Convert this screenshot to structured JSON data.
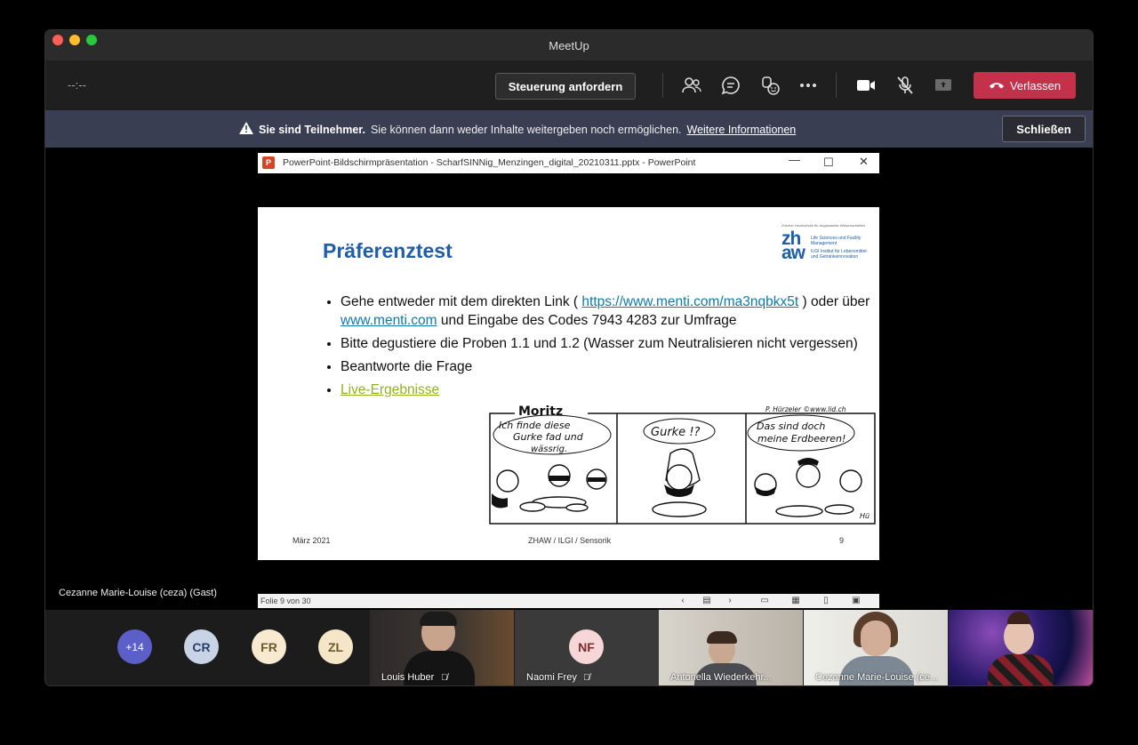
{
  "window": {
    "title": "MeetUp"
  },
  "toolbar": {
    "timer": "--:--",
    "request_control": "Steuerung anfordern",
    "leave": "Verlassen",
    "icons": [
      "people-icon",
      "chat-icon",
      "reactions-icon",
      "more-icon",
      "camera-icon",
      "mic-off-icon",
      "share-icon",
      "phone-icon"
    ]
  },
  "banner": {
    "bold": "Sie sind Teilnehmer.",
    "text": "Sie können dann weder Inhalte weitergeben noch ermöglichen.",
    "link": "Weitere Informationen",
    "close": "Schließen"
  },
  "powerpoint": {
    "title": "PowerPoint-Bildschirmpräsentation  -  ScharfSINNig_Menzingen_digital_20210311.pptx - PowerPoint",
    "status": "Folie 9 von 30"
  },
  "slide": {
    "title": "Präferenztest",
    "logo": {
      "mark_top": "zh",
      "mark_bottom": "aw",
      "text1": "Life Sciences und Facility Management",
      "text2": "ILGI Institut für Lebensmittel- und Getränkeinnovation",
      "tiny": "Zürcher Hochschule für Angewandte Wissenschaften"
    },
    "bullet1_a": "Gehe entweder mit dem direkten Link ( ",
    "bullet1_link": "https://www.menti.com/ma3nqbkx5t",
    "bullet1_b": " ) oder über ",
    "bullet1_link2": "www.menti.com",
    "bullet1_c": " und Eingabe des Codes 7943 4283 zur Umfrage",
    "bullet2": "Bitte degustiere die Proben 1.1 und 1.2 (Wasser zum Neutralisieren nicht vergessen)",
    "bullet3": "Beantworte die Frage",
    "bullet4": "Live-Ergebnisse",
    "comic": {
      "title": "Moritz",
      "credit": "P. Hürzeler ©www.lid.ch",
      "panel1": [
        "Ich finde diese",
        "Gurke fad und",
        "wässrig."
      ],
      "panel2": "Gurke !?",
      "panel3": [
        "Das sind doch",
        "meine Erdbeeren!"
      ],
      "sign": "Hü"
    },
    "footer_left": "März 2021",
    "footer_center": "ZHAW / ILGI / Sensorik",
    "footer_right": "9"
  },
  "presenter": "Cezanne Marie-Louise (ceza) (Gast)",
  "participants": {
    "overflow": "+14",
    "avatars": [
      {
        "initials": "CR",
        "bg": "#c8d3e6",
        "fg": "#2b3f6b"
      },
      {
        "initials": "FR",
        "bg": "#f7ead0",
        "fg": "#6b5a2b"
      },
      {
        "initials": "ZL",
        "bg": "#f5e6c8",
        "fg": "#6b5a2b"
      }
    ],
    "tiles": [
      {
        "name": "Louis Huber"
      },
      {
        "name": "Naomi Frey",
        "initials": "NF"
      },
      {
        "name": "Antonella Wiederkehr..."
      },
      {
        "name": "Cezanne Marie-Louise (ce..."
      },
      {
        "name": ""
      }
    ]
  },
  "colors": {
    "leave": "#c4314b",
    "banner": "#3a3e53",
    "slide_title": "#1f5ea8",
    "link": "#0f7aa6",
    "live": "#8fb31d"
  }
}
